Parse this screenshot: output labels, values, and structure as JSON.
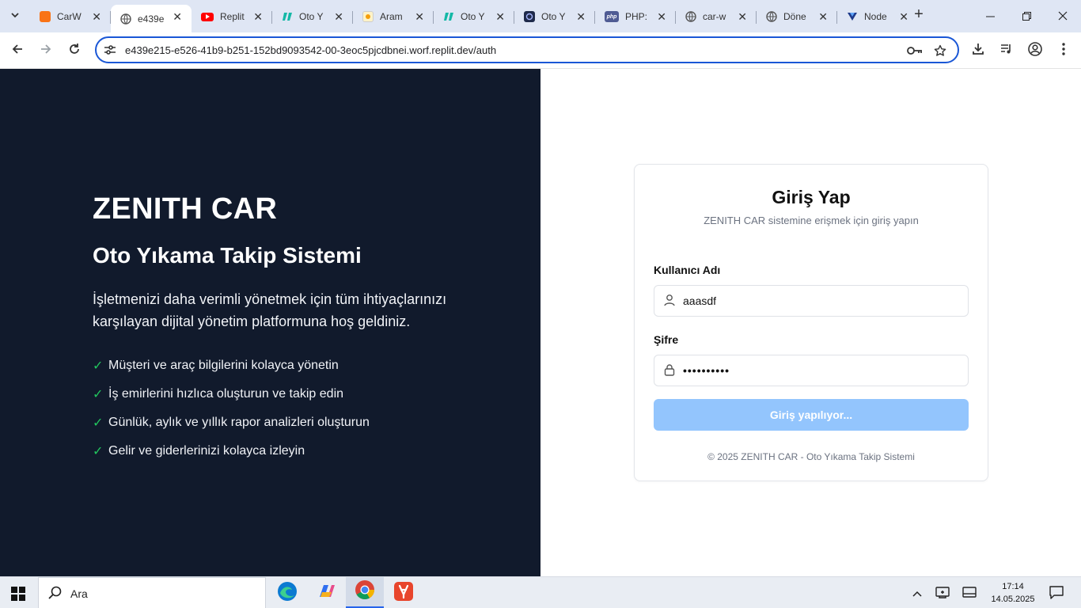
{
  "browser": {
    "tabs": [
      {
        "title": "CarW",
        "icon": "carwash-favicon-icon",
        "color": "#f97316"
      },
      {
        "title": "e439e",
        "icon": "globe-icon",
        "color": "#555555",
        "active": true
      },
      {
        "title": "Replit",
        "icon": "youtube-icon",
        "color": "#ff0000"
      },
      {
        "title": "Oto Y",
        "icon": "otoy-icon",
        "color": "#14b8a6"
      },
      {
        "title": "Aram",
        "icon": "search-favicon-icon",
        "color": "#f59e0b"
      },
      {
        "title": "Oto Y",
        "icon": "otoy-icon",
        "color": "#14b8a6"
      },
      {
        "title": "Oto Y",
        "icon": "otoy-dark-icon",
        "color": "#1e2a4a"
      },
      {
        "title": "PHP:",
        "icon": "php-icon",
        "color": "#4f5b93"
      },
      {
        "title": "car-w",
        "icon": "globe-icon",
        "color": "#555555"
      },
      {
        "title": "Döne",
        "icon": "globe-icon",
        "color": "#555555"
      },
      {
        "title": "Node",
        "icon": "vuetify-icon",
        "color": "#1e3a8a"
      }
    ],
    "url": "e439e215-e526-41b9-b251-152bd9093542-00-3eoc5pjcdbnei.worf.replit.dev/auth"
  },
  "hero": {
    "brand": "ZENITH CAR",
    "subtitle": "Oto Yıkama Takip Sistemi",
    "description": "İşletmenizi daha verimli yönetmek için tüm ihtiyaçlarınızı karşılayan dijital yönetim platformuna hoş geldiniz.",
    "check_glyph": "✓",
    "features": [
      "Müşteri ve araç bilgilerini kolayca yönetin",
      "İş emirlerini hızlıca oluşturun ve takip edin",
      "Günlük, aylık ve yıllık rapor analizleri oluşturun",
      "Gelir ve giderlerinizi kolayca izleyin"
    ]
  },
  "login": {
    "title": "Giriş Yap",
    "subtitle": "ZENITH CAR sistemine erişmek için giriş yapın",
    "username_label": "Kullanıcı Adı",
    "username_value": "aaasdf",
    "password_label": "Şifre",
    "password_value": "••••••••••",
    "submit_label": "Giriş yapılıyor...",
    "footer": "© 2025 ZENITH CAR - Oto Yıkama Takip Sistemi"
  },
  "taskbar": {
    "search_placeholder": "Ara",
    "time": "17:14",
    "date": "14.05.2025"
  },
  "colors": {
    "hero_bg": "#111a2c",
    "check": "#22c55e",
    "submit_disabled": "#93c5fd",
    "omnibox_border": "#1a57d6"
  }
}
